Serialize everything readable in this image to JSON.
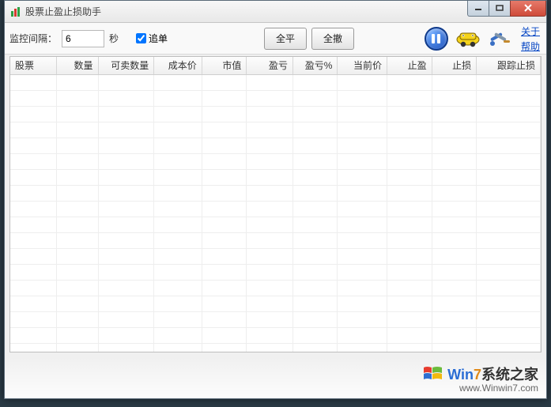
{
  "window": {
    "title": "股票止盈止损助手"
  },
  "toolbar": {
    "interval_label": "监控间隔：",
    "interval_value": "6",
    "interval_unit": "秒",
    "chase_label": "追单",
    "chase_checked": true,
    "btn_flat_all": "全平",
    "btn_cancel_all": "全撤"
  },
  "links": {
    "about": "关于",
    "help": "帮助"
  },
  "columns": [
    "股票",
    "数量",
    "可卖数量",
    "成本价",
    "市值",
    "盈亏",
    "盈亏%",
    "当前价",
    "止盈",
    "止损",
    "跟踪止损"
  ],
  "rows": [],
  "footer": {
    "brand_w": "W",
    "brand_in": "in",
    "brand_num": "7",
    "brand_zh": "系统之家",
    "url": "www.Winwin7.com"
  }
}
